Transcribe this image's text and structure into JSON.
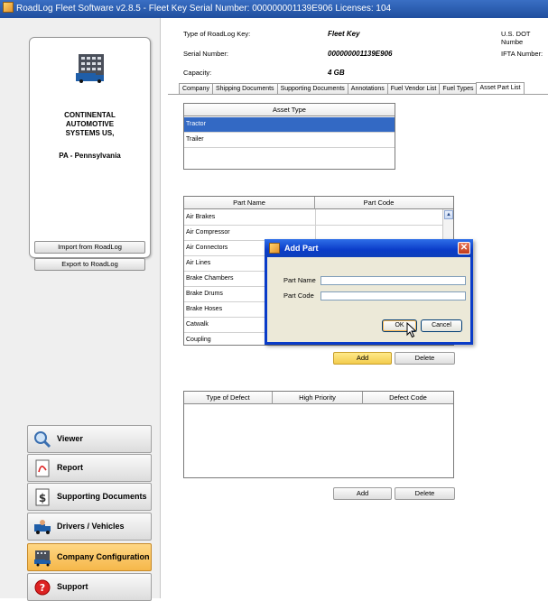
{
  "window": {
    "title": "RoadLog Fleet Software v2.8.5 - Fleet Key Serial Number: 000000001139E906 Licenses: 104"
  },
  "company": {
    "name": "CONTINENTAL\nAUTOMOTIVE\nSYSTEMS US,",
    "state": "PA - Pennsylvania",
    "import_label": "Import from RoadLog",
    "export_label": "Export to RoadLog"
  },
  "nav": [
    {
      "label": "Viewer",
      "icon": "magnifier-icon"
    },
    {
      "label": "Report",
      "icon": "pdf-report-icon"
    },
    {
      "label": "Supporting Documents",
      "icon": "dollar-document-icon"
    },
    {
      "label": "Drivers / Vehicles",
      "icon": "driver-truck-icon"
    },
    {
      "label": "Company Configuration",
      "icon": "truck-building-icon",
      "active": true
    },
    {
      "label": "Support",
      "icon": "help-icon"
    }
  ],
  "info": {
    "key_type_label": "Type of RoadLog Key:",
    "key_type_value": "Fleet Key",
    "serial_label": "Serial Number:",
    "serial_value": "000000001139E906",
    "capacity_label": "Capacity:",
    "capacity_value": "4 GB",
    "dot_label": "U.S. DOT Numbe",
    "ifta_label": "IFTA Number:"
  },
  "tabs": [
    "Company",
    "Shipping Documents",
    "Supporting Documents",
    "Annotations",
    "Fuel Vendor List",
    "Fuel Types",
    "Asset Part List"
  ],
  "active_tab": "Asset Part List",
  "asset_types": {
    "header": "Asset Type",
    "rows": [
      "Tractor",
      "Trailer"
    ],
    "selected": "Tractor"
  },
  "parts": {
    "headers": [
      "Part Name",
      "Part Code"
    ],
    "rows": [
      "Air Brakes",
      "Air Compressor",
      "Air Connectors",
      "Air Lines",
      "Brake Chambers",
      "Brake Drums",
      "Brake Hoses",
      "Catwalk",
      "Coupling"
    ],
    "add_label": "Add",
    "delete_label": "Delete"
  },
  "defects": {
    "headers": [
      "Type of Defect",
      "High Priority",
      "Defect Code"
    ],
    "add_label": "Add",
    "delete_label": "Delete"
  },
  "dialog": {
    "title": "Add Part",
    "part_name_label": "Part Name",
    "part_code_label": "Part Code",
    "ok_label": "OK",
    "cancel_label": "Cancel"
  }
}
